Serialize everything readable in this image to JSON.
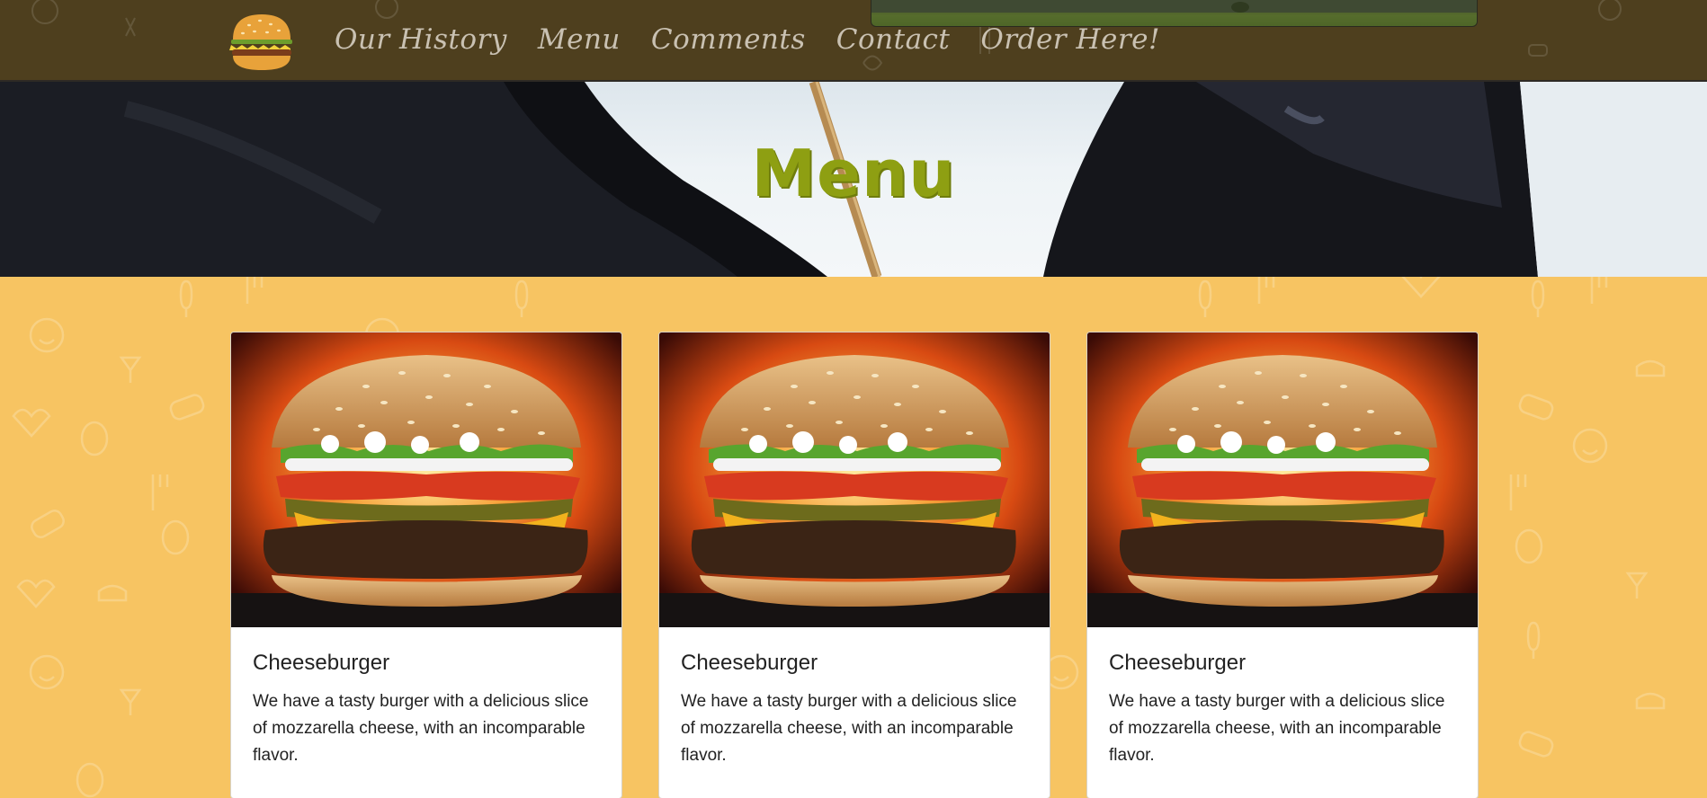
{
  "nav": {
    "logo_icon": "burger-logo-icon",
    "links": [
      "Our History",
      "Menu",
      "Comments",
      "Contact",
      "Order Here!"
    ]
  },
  "hero": {
    "title": "Menu"
  },
  "menu_items": [
    {
      "title": "Cheeseburger",
      "description": "We have a tasty burger with a delicious slice of mozzarella cheese, with an incomparable flavor.",
      "image_icon": "cheeseburger-photo"
    },
    {
      "title": "Cheeseburger",
      "description": "We have a tasty burger with a delicious slice of mozzarella cheese, with an incomparable flavor.",
      "image_icon": "cheeseburger-photo"
    },
    {
      "title": "Cheeseburger",
      "description": "We have a tasty burger with a delicious slice of mozzarella cheese, with an incomparable flavor.",
      "image_icon": "cheeseburger-photo"
    }
  ],
  "colors": {
    "navbar_bg": "#4e3f1e",
    "nav_link": "#c9c1b2",
    "hero_title": "#8e9f12",
    "page_bg": "#f7c462",
    "card_bg": "#ffffff"
  }
}
